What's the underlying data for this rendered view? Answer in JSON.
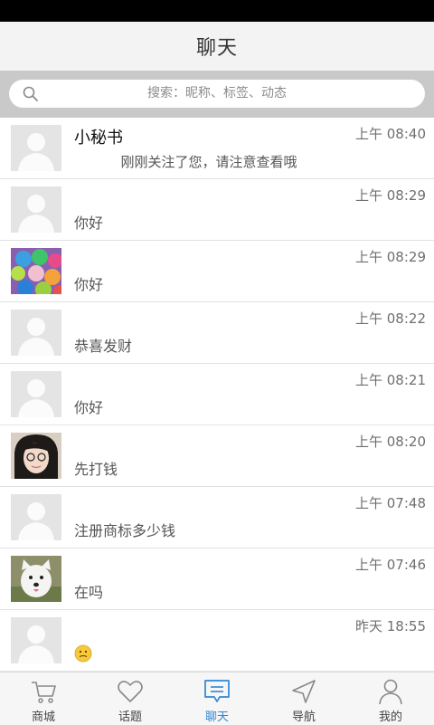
{
  "header": {
    "title": "聊天"
  },
  "search": {
    "placeholder": "搜索：昵称、标签、动态"
  },
  "chats": [
    {
      "name": "小秘书",
      "time": "上午 08:40",
      "message": "刚刚关注了您，请注意查看哦",
      "avatar": "default-avatar"
    },
    {
      "name": "",
      "time": "上午 08:29",
      "message": "你好",
      "avatar": "default-avatar"
    },
    {
      "name": "",
      "time": "上午 08:29",
      "message": "你好",
      "avatar": "colorful-balls-photo"
    },
    {
      "name": "",
      "time": "上午 08:22",
      "message": "恭喜发财",
      "avatar": "default-avatar"
    },
    {
      "name": "",
      "time": "上午 08:21",
      "message": "你好",
      "avatar": "default-avatar"
    },
    {
      "name": "",
      "time": "上午 08:20",
      "message": "先打钱",
      "avatar": "girl-portrait-photo"
    },
    {
      "name": "",
      "time": "上午 07:48",
      "message": "注册商标多少钱",
      "avatar": "default-avatar"
    },
    {
      "name": "",
      "time": "上午 07:46",
      "message": "在吗",
      "avatar": "white-dog-photo"
    },
    {
      "name": "",
      "time": "昨天 18:55",
      "message": "",
      "avatar": "default-avatar",
      "emoji": "awkward-face-emoji"
    }
  ],
  "tabs": [
    {
      "label": "商城",
      "icon": "cart-icon",
      "active": false
    },
    {
      "label": "话题",
      "icon": "heart-icon",
      "active": false
    },
    {
      "label": "聊天",
      "icon": "chat-bubble-icon",
      "active": true
    },
    {
      "label": "导航",
      "icon": "navigation-arrow-icon",
      "active": false
    },
    {
      "label": "我的",
      "icon": "person-icon",
      "active": false
    }
  ],
  "colors": {
    "accent": "#2f86d6",
    "search_bar_bg": "#c9c9c9",
    "title_bar_bg": "#f3f3f3"
  }
}
